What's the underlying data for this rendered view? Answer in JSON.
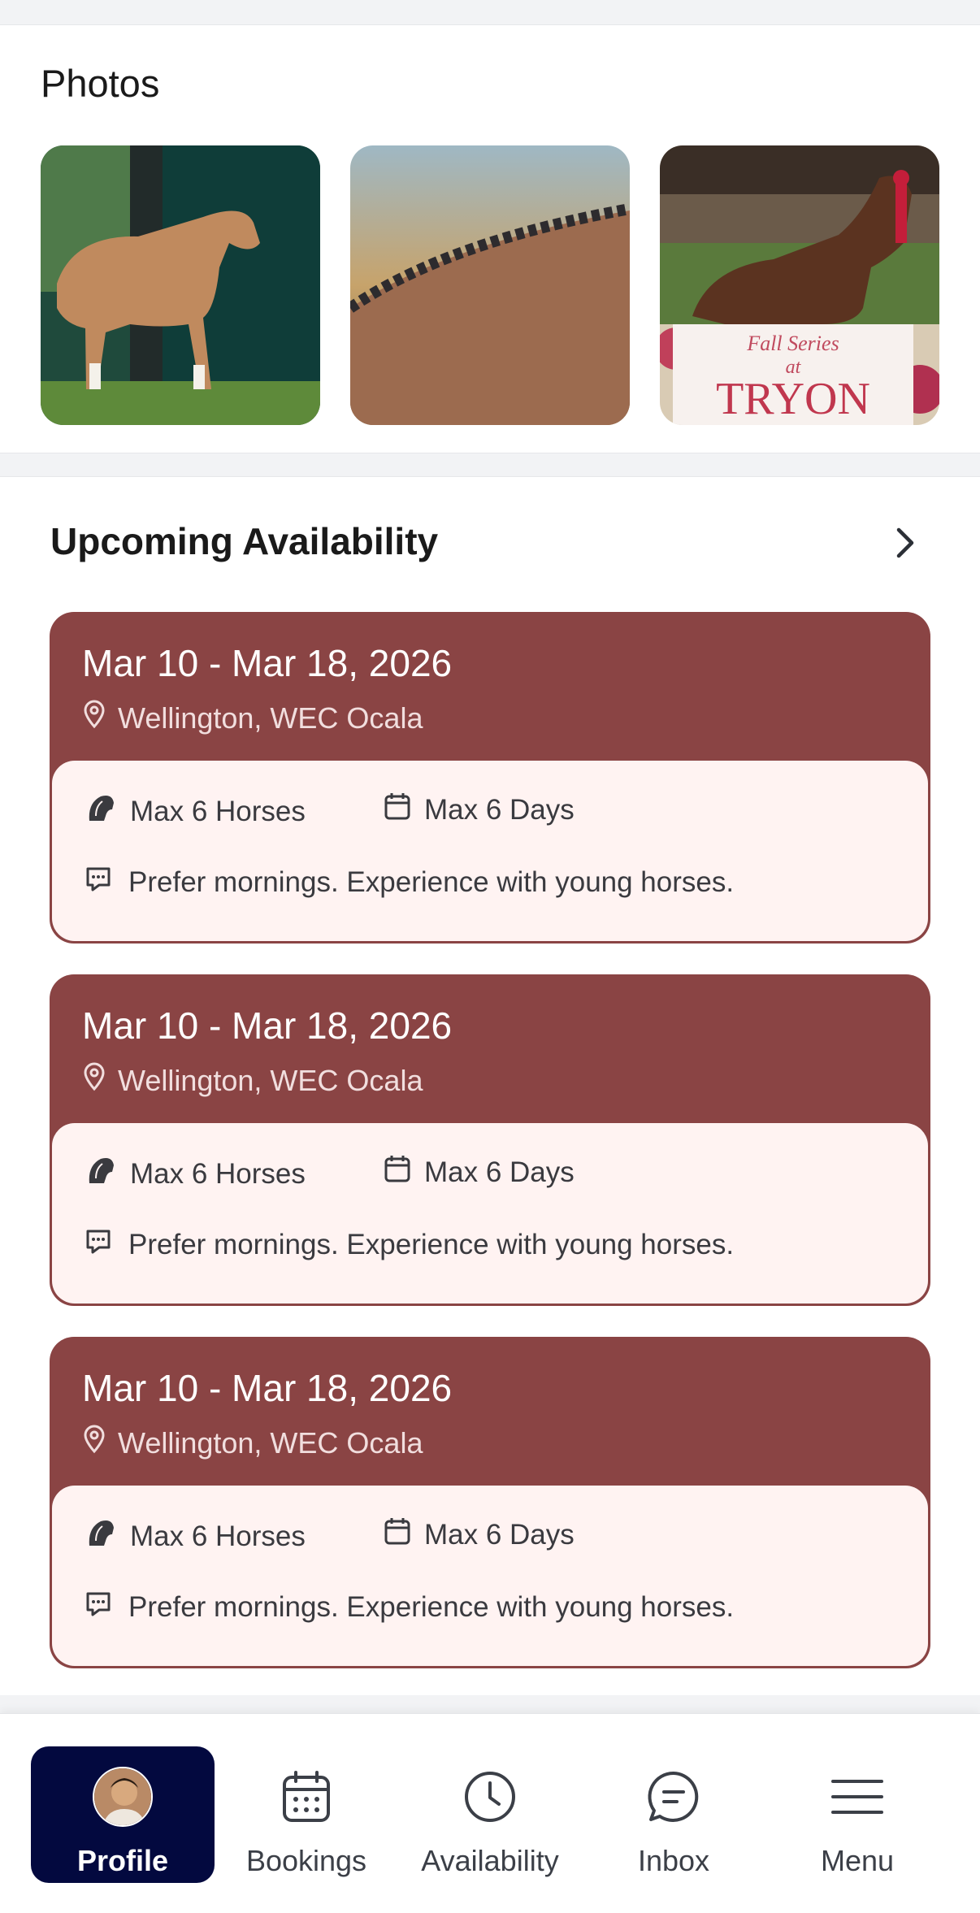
{
  "photos": {
    "title": "Photos",
    "items": [
      {
        "alt": "horse-standing-by-trailer"
      },
      {
        "alt": "braided-mane-closeup"
      },
      {
        "alt": "horse-at-show-ribbon",
        "sign_line1": "Fall Series",
        "sign_line2": "at",
        "sign_line3": "TRYON"
      }
    ]
  },
  "availability": {
    "title": "Upcoming Availability",
    "slots": [
      {
        "dates": "Mar 10 - Mar 18, 2026",
        "location": "Wellington, WEC Ocala",
        "max_horses": "Max 6 Horses",
        "max_days": "Max 6 Days",
        "note": "Prefer mornings. Experience with young horses."
      },
      {
        "dates": "Mar 10 - Mar 18, 2026",
        "location": "Wellington, WEC Ocala",
        "max_horses": "Max 6 Horses",
        "max_days": "Max 6 Days",
        "note": "Prefer mornings. Experience with young horses."
      },
      {
        "dates": "Mar 10 - Mar 18, 2026",
        "location": "Wellington, WEC Ocala",
        "max_horses": "Max 6 Horses",
        "max_days": "Max 6 Days",
        "note": "Prefer mornings. Experience with young horses."
      }
    ]
  },
  "nav": {
    "items": [
      {
        "label": "Profile",
        "icon": "avatar",
        "active": true
      },
      {
        "label": "Bookings",
        "icon": "calendar-icon"
      },
      {
        "label": "Availability",
        "icon": "clock-icon"
      },
      {
        "label": "Inbox",
        "icon": "chat-icon"
      },
      {
        "label": "Menu",
        "icon": "hamburger-icon"
      }
    ]
  },
  "colors": {
    "slot_header": "#8a4444",
    "slot_body": "#fff3f2",
    "nav_active": "#03093f"
  }
}
